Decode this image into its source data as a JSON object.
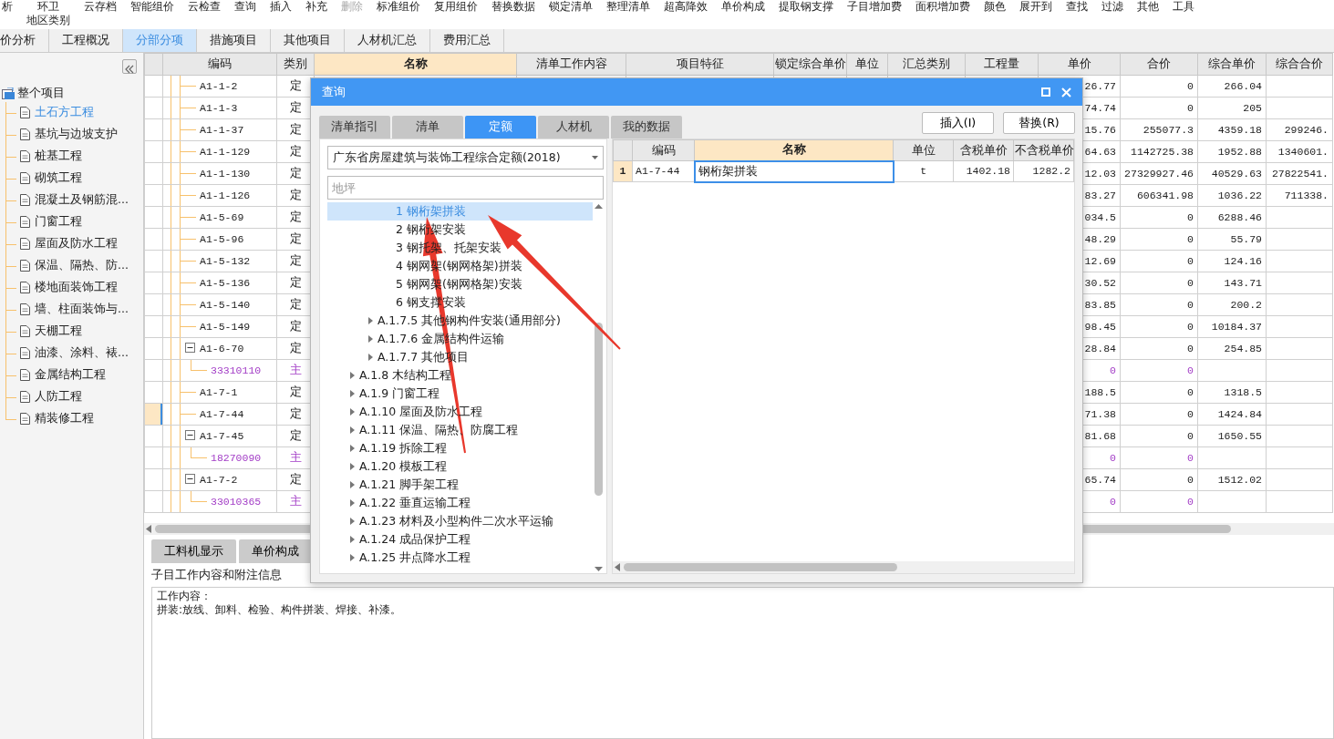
{
  "toolbar": [
    {
      "label": "析",
      "disabled": false
    },
    {
      "label": "环卫",
      "second_line": "地区类别",
      "disabled": false
    },
    {
      "label": "云存档",
      "disabled": false
    },
    {
      "label": "智能组价",
      "disabled": false
    },
    {
      "label": "云检查",
      "disabled": false
    },
    {
      "label": "查询",
      "disabled": false
    },
    {
      "label": "插入",
      "disabled": false
    },
    {
      "label": "补充",
      "disabled": false
    },
    {
      "label": "删除",
      "disabled": true
    },
    {
      "label": "标准组价",
      "disabled": false
    },
    {
      "label": "复用组价",
      "disabled": false
    },
    {
      "label": "替换数据",
      "disabled": false
    },
    {
      "label": "锁定清单",
      "disabled": false
    },
    {
      "label": "整理清单",
      "disabled": false
    },
    {
      "label": "超高降效",
      "disabled": false
    },
    {
      "label": "单价构成",
      "disabled": false
    },
    {
      "label": "提取钢支撑",
      "disabled": false
    },
    {
      "label": "子目增加费",
      "disabled": false
    },
    {
      "label": "面积增加费",
      "disabled": false
    },
    {
      "label": "颜色",
      "disabled": false
    },
    {
      "label": "展开到",
      "disabled": false
    },
    {
      "label": "查找",
      "disabled": false
    },
    {
      "label": "过滤",
      "disabled": false
    },
    {
      "label": "其他",
      "disabled": false
    },
    {
      "label": "工具",
      "disabled": false
    }
  ],
  "tabs": [
    {
      "label": "价分析",
      "selected": false
    },
    {
      "label": "工程概况",
      "selected": false
    },
    {
      "label": "分部分项",
      "selected": true
    },
    {
      "label": "措施项目",
      "selected": false
    },
    {
      "label": "其他项目",
      "selected": false
    },
    {
      "label": "人材机汇总",
      "selected": false
    },
    {
      "label": "费用汇总",
      "selected": false
    }
  ],
  "sidebar": {
    "root": {
      "label": "整个项目",
      "children": [
        {
          "label": "土石方工程",
          "selected": true
        },
        {
          "label": "基坑与边坡支护",
          "selected": false
        },
        {
          "label": "桩基工程",
          "selected": false
        },
        {
          "label": "砌筑工程",
          "selected": false
        },
        {
          "label": "混凝土及钢筋混...",
          "selected": false
        },
        {
          "label": "门窗工程",
          "selected": false
        },
        {
          "label": "屋面及防水工程",
          "selected": false
        },
        {
          "label": "保温、隔热、防...",
          "selected": false
        },
        {
          "label": "楼地面装饰工程",
          "selected": false
        },
        {
          "label": "墙、柱面装饰与...",
          "selected": false
        },
        {
          "label": "天棚工程",
          "selected": false
        },
        {
          "label": "油漆、涂料、裱...",
          "selected": false
        },
        {
          "label": "金属结构工程",
          "selected": false
        },
        {
          "label": "人防工程",
          "selected": false
        },
        {
          "label": "精装修工程",
          "selected": false
        }
      ]
    }
  },
  "table": {
    "columns": [
      {
        "label": "编码",
        "selected": false
      },
      {
        "label": "类别",
        "selected": false
      },
      {
        "label": "名称",
        "selected": true
      },
      {
        "label": "清单工作内容",
        "selected": false
      },
      {
        "label": "项目特征",
        "selected": false
      },
      {
        "label": "锁定综合单价",
        "selected": false
      },
      {
        "label": "单位",
        "selected": false
      },
      {
        "label": "汇总类别",
        "selected": false
      },
      {
        "label": "工程量",
        "selected": false
      },
      {
        "label": "单价",
        "selected": false
      },
      {
        "label": "合价",
        "selected": false
      },
      {
        "label": "综合单价",
        "selected": false
      },
      {
        "label": "综合合价",
        "selected": false
      }
    ],
    "rows": [
      {
        "kind": "item",
        "selected": false,
        "code": "A1-1-2",
        "type": "定",
        "unit_price": "26.77",
        "total": "0",
        "comp_price": "266.04"
      },
      {
        "kind": "item",
        "selected": false,
        "code": "A1-1-3",
        "type": "定",
        "unit_price": "74.74",
        "total": "0",
        "comp_price": "205"
      },
      {
        "kind": "item",
        "selected": false,
        "code": "A1-1-37",
        "type": "定",
        "unit_price": "15.76",
        "total": "255077.3",
        "comp_price": "4359.18",
        "comp_total": "299246."
      },
      {
        "kind": "item",
        "selected": false,
        "code": "A1-1-129",
        "type": "定",
        "unit_price": "64.63",
        "total": "1142725.38",
        "comp_price": "1952.88",
        "comp_total": "1340601."
      },
      {
        "kind": "item",
        "selected": false,
        "code": "A1-1-130",
        "type": "定",
        "unit_price": "12.03",
        "total": "27329927.46",
        "comp_price": "40529.63",
        "comp_total": "27822541."
      },
      {
        "kind": "item",
        "selected": false,
        "code": "A1-1-126",
        "type": "定",
        "unit_price": "83.27",
        "total": "606341.98",
        "comp_price": "1036.22",
        "comp_total": "711338."
      },
      {
        "kind": "item",
        "selected": false,
        "code": "A1-5-69",
        "type": "定",
        "unit_price": "034.5",
        "total": "0",
        "comp_price": "6288.46"
      },
      {
        "kind": "item",
        "selected": false,
        "code": "A1-5-96",
        "type": "定",
        "unit_price": "48.29",
        "total": "0",
        "comp_price": "55.79"
      },
      {
        "kind": "item",
        "selected": false,
        "code": "A1-5-132",
        "type": "定",
        "unit_price": "12.69",
        "total": "0",
        "comp_price": "124.16"
      },
      {
        "kind": "item",
        "selected": false,
        "code": "A1-5-136",
        "type": "定",
        "unit_price": "30.52",
        "total": "0",
        "comp_price": "143.71"
      },
      {
        "kind": "item",
        "selected": false,
        "code": "A1-5-140",
        "type": "定",
        "unit_price": "83.85",
        "total": "0",
        "comp_price": "200.2"
      },
      {
        "kind": "item",
        "selected": false,
        "code": "A1-5-149",
        "type": "定",
        "unit_price": "98.45",
        "total": "0",
        "comp_price": "10184.37"
      },
      {
        "kind": "group",
        "expanded": true,
        "selected": false,
        "code": "A1-6-70",
        "type": "定",
        "unit_price": "28.84",
        "total": "0",
        "comp_price": "254.85"
      },
      {
        "kind": "material",
        "selected": false,
        "code": "33310110",
        "type": "主",
        "unit_price": "0",
        "total": "0"
      },
      {
        "kind": "item",
        "selected": false,
        "code": "A1-7-1",
        "type": "定",
        "unit_price": "188.5",
        "total": "0",
        "comp_price": "1318.5"
      },
      {
        "kind": "item",
        "selected": true,
        "code": "A1-7-44",
        "type": "定",
        "unit_price": "71.38",
        "total": "0",
        "comp_price": "1424.84"
      },
      {
        "kind": "group",
        "expanded": true,
        "selected": false,
        "code": "A1-7-45",
        "type": "定",
        "unit_price": "81.68",
        "total": "0",
        "comp_price": "1650.55"
      },
      {
        "kind": "material",
        "selected": false,
        "code": "18270090",
        "type": "主",
        "unit_price": "0",
        "total": "0"
      },
      {
        "kind": "group",
        "expanded": true,
        "selected": false,
        "code": "A1-7-2",
        "type": "定",
        "unit_price": "65.74",
        "total": "0",
        "comp_price": "1512.02"
      },
      {
        "kind": "material",
        "selected": false,
        "code": "33010365",
        "type": "主",
        "unit_price": "0",
        "total": "0"
      }
    ]
  },
  "bottom": {
    "tabs": [
      {
        "label": "工料机显示"
      },
      {
        "label": "单价构成"
      }
    ],
    "section_label": "子目工作内容和附注信息",
    "notes": [
      "工作内容：",
      "拼装:放线、卸料、检验、构件拼装、焊接、补漆。"
    ]
  },
  "dialog": {
    "title": "查询",
    "tabs": [
      {
        "label": "清单指引",
        "selected": false
      },
      {
        "label": "清单",
        "selected": false
      },
      {
        "label": "定额",
        "selected": true
      },
      {
        "label": "人材机",
        "selected": false
      },
      {
        "label": "我的数据",
        "selected": false
      }
    ],
    "buttons": [
      "插入(I)",
      "替换(R)"
    ],
    "library": "广东省房屋建筑与装饰工程综合定额(2018)",
    "search": {
      "placeholder": "地坪"
    },
    "tree": [
      {
        "children": [
          {
            "children": [
              {
                "label": "1 钢桁架拼装",
                "selected": true
              },
              {
                "label": "2 钢桁架安装",
                "selected": false
              },
              {
                "label": "3 钢托架、托架安装",
                "selected": false
              },
              {
                "label": "4 钢网架(钢网格架)拼装",
                "selected": false
              },
              {
                "label": "5 钢网架(钢网格架)安装",
                "selected": false
              },
              {
                "label": "6 钢支撑安装",
                "selected": false
              }
            ]
          },
          {
            "label": "A.1.7.5 其他钢构件安装(通用部分)",
            "expanded": false,
            "selected": false
          },
          {
            "label": "A.1.7.6 金属结构件运输",
            "expanded": false,
            "selected": false
          },
          {
            "label": "A.1.7.7 其他项目",
            "expanded": false,
            "selected": false
          }
        ]
      },
      {
        "label": "A.1.8 木结构工程",
        "expanded": false,
        "selected": false
      },
      {
        "label": "A.1.9 门窗工程",
        "expanded": false,
        "selected": false
      },
      {
        "label": "A.1.10 屋面及防水工程",
        "expanded": false,
        "selected": false
      },
      {
        "label": "A.1.11 保温、隔热、防腐工程",
        "expanded": false,
        "selected": false
      },
      {
        "label": "A.1.19 拆除工程",
        "expanded": false,
        "selected": false
      },
      {
        "label": "A.1.20 模板工程",
        "expanded": false,
        "selected": false
      },
      {
        "label": "A.1.21 脚手架工程",
        "expanded": false,
        "selected": false
      },
      {
        "label": "A.1.22 垂直运输工程",
        "expanded": false,
        "selected": false
      },
      {
        "label": "A.1.23 材料及小型构件二次水平运输",
        "expanded": false,
        "selected": false
      },
      {
        "label": "A.1.24 成品保护工程",
        "expanded": false,
        "selected": false
      },
      {
        "label": "A.1.25 井点降水工程",
        "expanded": false,
        "selected": false
      }
    ],
    "grid": {
      "columns": [
        {
          "label": "编码",
          "selected": false
        },
        {
          "label": "名称",
          "selected": true
        },
        {
          "label": "单位",
          "selected": false
        },
        {
          "label": "含税单价",
          "selected": false
        },
        {
          "label": "不含税单价",
          "selected": false
        }
      ],
      "rows": [
        {
          "number": "1",
          "selected": true,
          "cells": [
            "A1-7-44",
            "钢桁架拼装",
            "t",
            "1402.18",
            "1282.2"
          ]
        }
      ]
    }
  }
}
